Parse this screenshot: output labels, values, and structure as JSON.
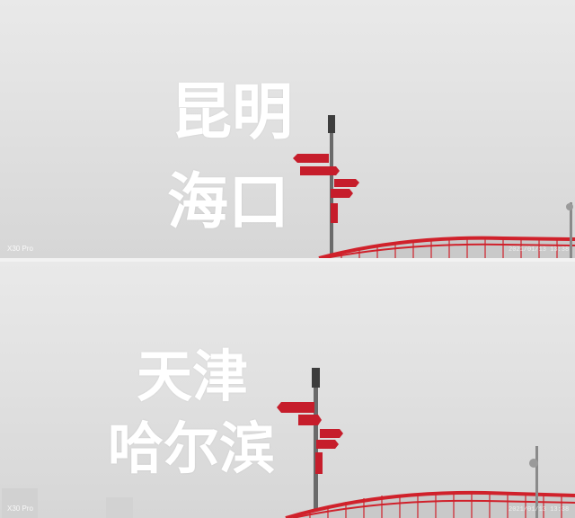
{
  "top_panel": {
    "overlay_line1": "昆明",
    "overlay_line2": "海口",
    "camera_watermark": "X30 Pro",
    "timestamp": "2021/01/13 13:38"
  },
  "bottom_panel": {
    "overlay_line1": "天津",
    "overlay_line2": "哈尔滨",
    "camera_watermark": "X30 Pro",
    "timestamp": "2021/01/13 13:38"
  },
  "colors": {
    "fog_sky": "#e4e4e4",
    "railing_red": "#d0212b",
    "sign_red": "#c61d2b",
    "overlay_text": "#ffffff"
  }
}
